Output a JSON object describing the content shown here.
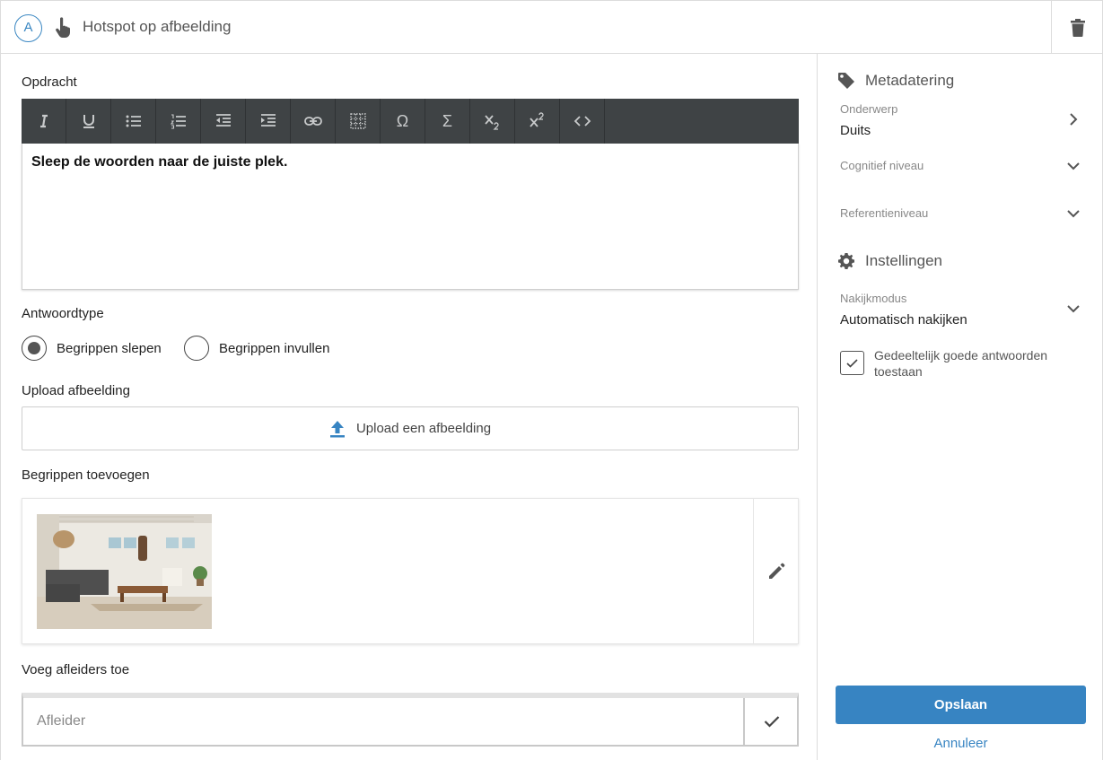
{
  "header": {
    "badge": "A",
    "title": "Hotspot op afbeelding"
  },
  "main": {
    "assignment_label": "Opdracht",
    "editor_text": "Sleep de woorden naar de juiste plek.",
    "toolbar": {
      "omega": "Ω",
      "sigma": "Σ"
    },
    "answer_type_label": "Antwoordtype",
    "answer_types": [
      {
        "label": "Begrippen slepen",
        "selected": true
      },
      {
        "label": "Begrippen invullen",
        "selected": false
      }
    ],
    "upload_label": "Upload afbeelding",
    "upload_button": "Upload een afbeelding",
    "terms_label": "Begrippen toevoegen",
    "distractors_label": "Voeg afleiders toe",
    "distractor_placeholder": "Afleider"
  },
  "sidebar": {
    "metadata_heading": "Metadatering",
    "subject_label": "Onderwerp",
    "subject_value": "Duits",
    "cognitive_label": "Cognitief niveau",
    "reference_label": "Referentieniveau",
    "settings_heading": "Instellingen",
    "review_mode_label": "Nakijkmodus",
    "review_mode_value": "Automatisch nakijken",
    "partial_checkbox_label": "Gedeeltelijk goede antwoorden toestaan",
    "partial_checked": true,
    "save_button": "Opslaan",
    "cancel_link": "Annuleer"
  },
  "colors": {
    "accent": "#3784c2",
    "toolbar_bg": "#3f4345"
  }
}
